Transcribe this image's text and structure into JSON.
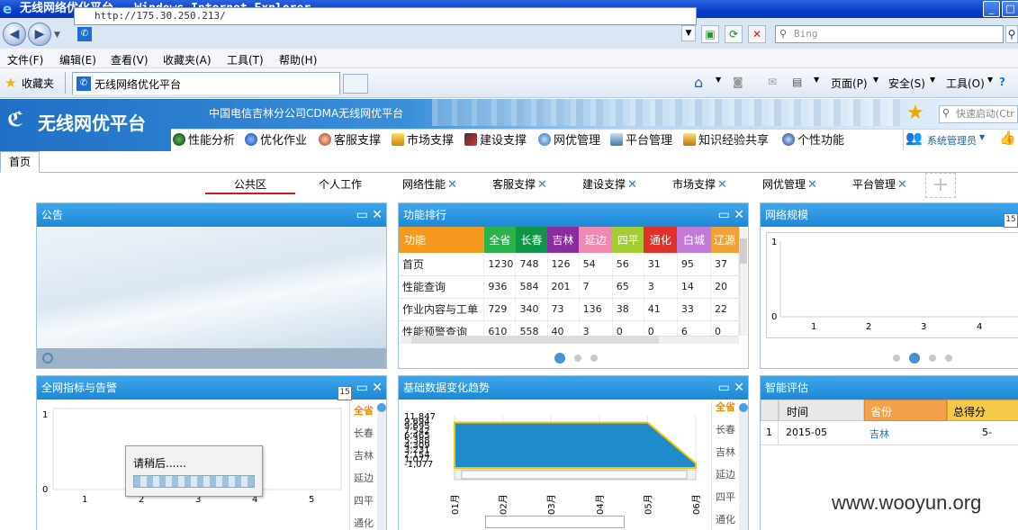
{
  "window": {
    "title": "无线网络优化平台 - Windows Internet Explorer"
  },
  "browser": {
    "url": "http://175.30.250.213/",
    "search_placeholder": "Bing",
    "menu": [
      "文件(F)",
      "编辑(E)",
      "查看(V)",
      "收藏夹(A)",
      "工具(T)",
      "帮助(H)"
    ],
    "favorites": "收藏夹",
    "tab_title": "无线网络优化平台",
    "toolbar": {
      "page": "页面(P)",
      "safety": "安全(S)",
      "tools": "工具(O)"
    }
  },
  "app": {
    "logo": "无线网优平台",
    "subtitle": "中国电信吉林分公司CDMA无线网优平台",
    "quick_search_placeholder": "快速启动(Ctr",
    "user": "系统管理员",
    "nav": [
      "性能分析",
      "优化作业",
      "客服支撑",
      "市场支撑",
      "建设支撑",
      "网优管理",
      "平台管理",
      "知识经验共享",
      "个性功能"
    ]
  },
  "home_tab": "首页",
  "content_tabs": [
    "公共区",
    "个人工作",
    "网络性能",
    "客服支撑",
    "建设支撑",
    "市场支撑",
    "网优管理",
    "平台管理"
  ],
  "panels": {
    "notice": {
      "title": "公告"
    },
    "ranking": {
      "title": "功能排行",
      "headers": [
        "功能",
        "全省",
        "长春",
        "吉林",
        "延边",
        "四平",
        "通化",
        "白城",
        "辽源"
      ],
      "header_colors": [
        "#f59a1f",
        "#2cb24a",
        "#109447",
        "#8a2ba0",
        "#f08ab0",
        "#a4cc34",
        "#e0322c",
        "#c07bd8",
        "#f0a23a"
      ],
      "rows": [
        [
          "首页",
          "1230",
          "748",
          "126",
          "54",
          "56",
          "31",
          "95",
          "37"
        ],
        [
          "性能查询",
          "936",
          "584",
          "201",
          "7",
          "65",
          "3",
          "14",
          "20"
        ],
        [
          "作业内容与工单",
          "729",
          "340",
          "73",
          "136",
          "38",
          "41",
          "33",
          "22"
        ],
        [
          "性能预警查询",
          "610",
          "558",
          "40",
          "3",
          "0",
          "0",
          "6",
          "0"
        ]
      ]
    },
    "scale": {
      "title": "网络规模",
      "y_ticks": [
        "1",
        "0"
      ],
      "x_ticks": [
        "1",
        "2",
        "3",
        "4"
      ]
    },
    "alarms": {
      "title": "全网指标与告警",
      "y_ticks": [
        "1",
        "0"
      ],
      "x_ticks": [
        "1",
        "2",
        "3",
        "4",
        "5"
      ],
      "cities": [
        "全省",
        "长春",
        "吉林",
        "延边",
        "四平",
        "通化"
      ],
      "loading": "请稍后......"
    },
    "trend": {
      "title": "基础数据变化趋势",
      "y_ticks": [
        "11,847",
        "9,694",
        "9,695",
        "7,542",
        "6,465",
        "5,388",
        "4,309",
        "3,231",
        "2,154",
        "1,077",
        "-1,077"
      ],
      "x_ticks": [
        "01月",
        "02月",
        "03月",
        "04月",
        "05月",
        "06月"
      ],
      "cities": [
        "全省",
        "长春",
        "吉林",
        "延边",
        "四平",
        "通化"
      ]
    },
    "eval": {
      "title": "智能评估",
      "headers": [
        "时间",
        "省份",
        "总得分"
      ],
      "rows": [
        [
          "1",
          "2015-05",
          "吉林",
          "5-"
        ]
      ]
    }
  },
  "watermark": "www.wooyun.org",
  "chart_data": [
    {
      "type": "line",
      "title": "网络规模",
      "x": [
        1,
        2,
        3,
        4
      ],
      "ylim": [
        0,
        1
      ],
      "series": []
    },
    {
      "type": "line",
      "title": "全网指标与告警",
      "x": [
        1,
        2,
        3,
        4,
        5
      ],
      "ylim": [
        0,
        1
      ],
      "series": []
    },
    {
      "type": "area",
      "title": "基础数据变化趋势",
      "categories": [
        "01月",
        "02月",
        "03月",
        "04月",
        "05月",
        "06月"
      ],
      "ylim": [
        -1077,
        11847
      ],
      "series": [
        {
          "values": [
            9694,
            9694,
            9694,
            9694,
            9694,
            0
          ]
        }
      ]
    }
  ]
}
